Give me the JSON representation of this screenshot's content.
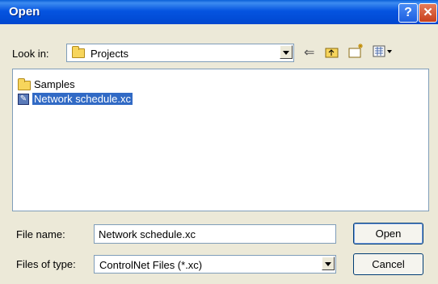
{
  "titlebar": {
    "title": "Open",
    "help_glyph": "?",
    "close_glyph": "✕"
  },
  "lookin": {
    "label": "Look in:",
    "value": "Projects"
  },
  "toolbar": {
    "back_icon": "back-arrow-icon",
    "up_icon": "up-folder-icon",
    "newfolder_icon": "new-folder-icon",
    "view_icon": "view-menu-icon"
  },
  "files": [
    {
      "name": "Samples",
      "type": "folder",
      "selected": false
    },
    {
      "name": "Network schedule.xc",
      "type": "file",
      "selected": true
    }
  ],
  "filename": {
    "label": "File name:",
    "value": "Network schedule.xc"
  },
  "filetype": {
    "label": "Files of type:",
    "value": "ControlNet Files (*.xc)"
  },
  "buttons": {
    "open": "Open",
    "cancel": "Cancel"
  },
  "colors": {
    "selection": "#316ac5",
    "titlebar": "#0554e0",
    "face": "#ece9d8"
  }
}
